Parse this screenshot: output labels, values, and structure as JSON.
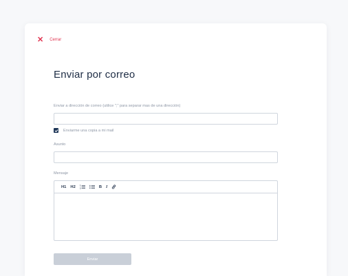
{
  "dialog": {
    "close_label": "Cerrar",
    "title": "Enviar por correo"
  },
  "form": {
    "email_label": "Enviar a dirección de correo (utilice \";\" para separar mas de una dirección)",
    "email_value": "",
    "copy_checkbox_label": "Enviarme una copia a mi mail",
    "copy_checked": true,
    "subject_label": "Asunto",
    "subject_value": "",
    "message_label": "Mensaje",
    "message_value": "",
    "toolbar": {
      "h1": "H1",
      "h2": "H2",
      "ordered_list": "ordered-list-icon",
      "bullet_list": "bullet-list-icon",
      "bold": "B",
      "italic": "I",
      "link": "link-icon"
    },
    "submit_label": "Enviar"
  },
  "colors": {
    "accent_red": "#e0334f",
    "title_navy": "#1d2c44",
    "checkbox": "#1d3557",
    "button_disabled": "#c9cfd8",
    "border": "#cfd5dd"
  }
}
